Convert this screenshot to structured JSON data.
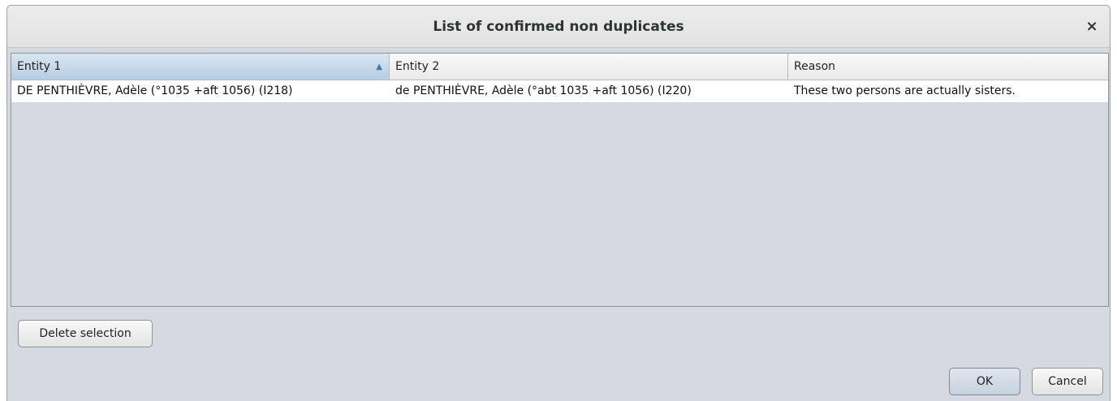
{
  "dialog": {
    "title": "List of confirmed non duplicates",
    "close_glyph": "×"
  },
  "table": {
    "columns": [
      {
        "label": "Entity 1",
        "sorted": "ascending",
        "sort_glyph": "▲"
      },
      {
        "label": "Entity 2"
      },
      {
        "label": "Reason"
      }
    ],
    "rows": [
      {
        "entity1": "DE PENTHIÈVRE, Adèle (°1035 +aft 1056) (I218)",
        "entity2": "de PENTHIÈVRE, Adèle (°abt 1035 +aft 1056) (I220)",
        "reason": "These two persons are actually sisters."
      }
    ]
  },
  "buttons": {
    "delete_label": "Delete selection",
    "ok_label": "OK",
    "cancel_label": "Cancel"
  },
  "icons": {
    "close": "close-icon",
    "sort": "sort-ascending-icon"
  }
}
